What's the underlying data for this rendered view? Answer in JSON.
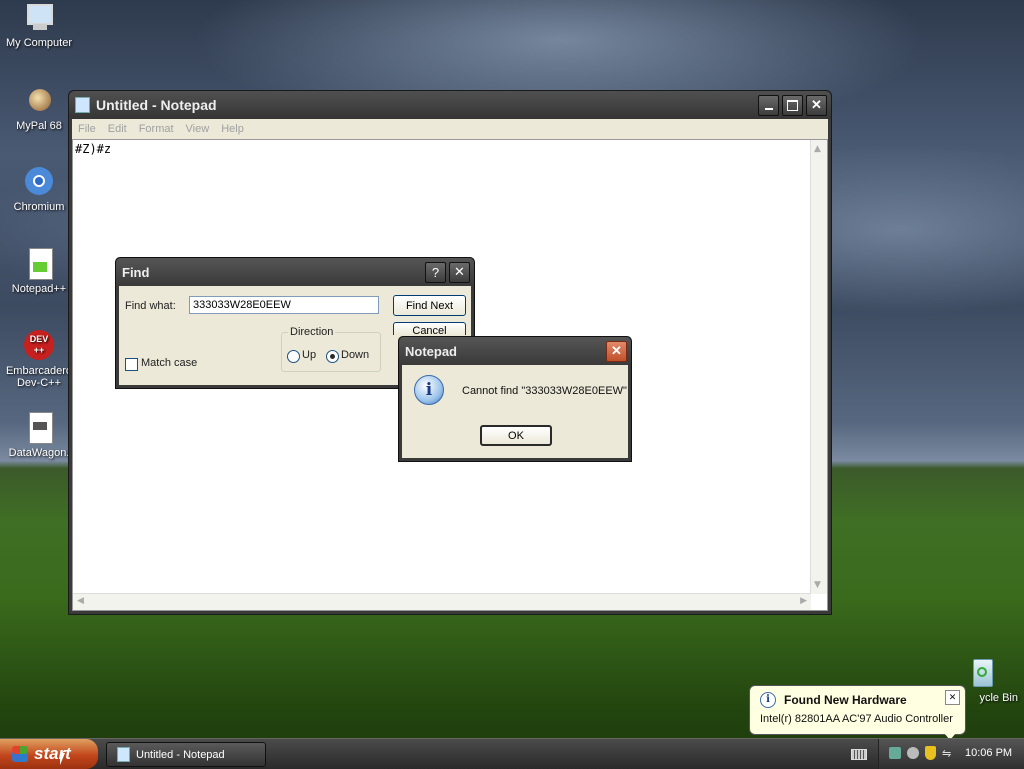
{
  "desktop": {
    "icons": [
      {
        "label": "My Computer"
      },
      {
        "label": "MyPal 68"
      },
      {
        "label": "Chromium"
      },
      {
        "label": "Notepad++"
      },
      {
        "label": "Embarcadero\nDev-C++"
      },
      {
        "label": "DataWagon."
      },
      {
        "label": "ycle Bin"
      }
    ]
  },
  "notepad": {
    "title": "Untitled - Notepad",
    "menu": [
      "File",
      "Edit",
      "Format",
      "View",
      "Help"
    ],
    "content": "#Z)#z"
  },
  "find_dialog": {
    "title": "Find",
    "help_glyph": "?",
    "find_what_label": "Find what:",
    "find_what_value": "333033W28E0EEW",
    "find_next_label": "Find Next",
    "cancel_label": "Cancel",
    "direction_label": "Direction",
    "up_label": "Up",
    "down_label": "Down",
    "selected_direction": "Down",
    "match_case_label": "Match case",
    "match_case_checked": false
  },
  "message_box": {
    "title": "Notepad",
    "message": "Cannot find \"333033W28E0EEW\"",
    "ok_label": "OK",
    "icon": "info-icon"
  },
  "taskbar": {
    "start_label": "start",
    "task_button_label": "Untitled - Notepad",
    "clock": "10:06 PM"
  },
  "balloon": {
    "title": "Found New Hardware",
    "text": "Intel(r) 82801AA AC'97 Audio Controller"
  }
}
